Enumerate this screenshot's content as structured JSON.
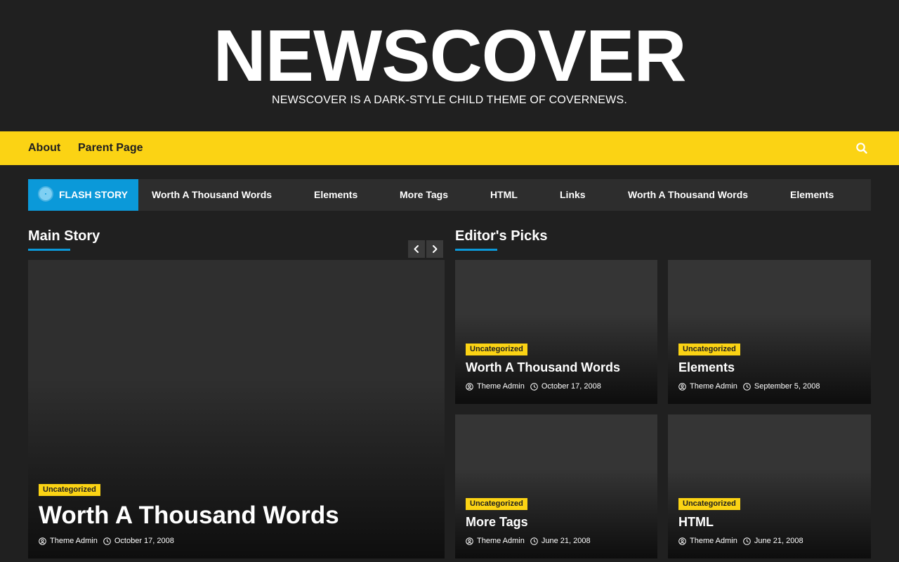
{
  "site": {
    "title": "NEWSCOVER",
    "tagline": "NEWSCOVER IS A DARK-STYLE CHILD THEME OF COVERNEWS."
  },
  "nav": {
    "items": [
      "About",
      "Parent Page"
    ],
    "search_icon": "search-icon"
  },
  "flash": {
    "label": "FLASH STORY",
    "items": [
      "Worth A Thousand Words",
      "Elements",
      "More Tags",
      "HTML",
      "Links",
      "Worth A Thousand Words",
      "Elements"
    ]
  },
  "main_story": {
    "heading": "Main Story",
    "category": "Uncategorized",
    "title": "Worth A Thousand Words",
    "author": "Theme Admin",
    "date": "October 17, 2008"
  },
  "editors_picks": {
    "heading": "Editor's Picks",
    "cards": [
      {
        "category": "Uncategorized",
        "title": "Worth A Thousand Words",
        "author": "Theme Admin",
        "date": "October 17, 2008"
      },
      {
        "category": "Uncategorized",
        "title": "Elements",
        "author": "Theme Admin",
        "date": "September 5, 2008"
      },
      {
        "category": "Uncategorized",
        "title": "More Tags",
        "author": "Theme Admin",
        "date": "June 21, 2008"
      },
      {
        "category": "Uncategorized",
        "title": "HTML",
        "author": "Theme Admin",
        "date": "June 21, 2008"
      }
    ]
  },
  "colors": {
    "background": "#202020",
    "accent_yellow": "#fbd314",
    "accent_blue": "#0b99d9"
  }
}
